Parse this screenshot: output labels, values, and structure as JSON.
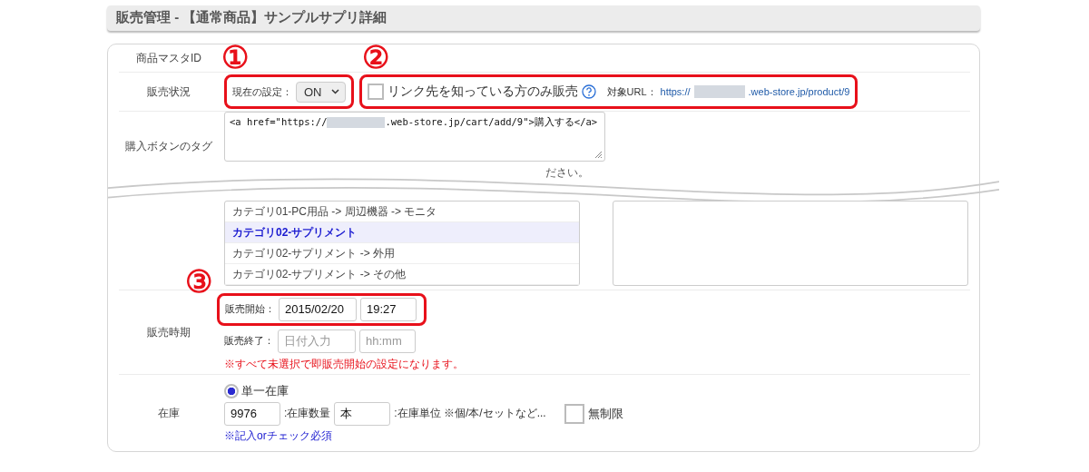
{
  "page_title": "販売管理 - 【通常商品】サンプルサプリ詳細",
  "master_id": {
    "label": "商品マスタID"
  },
  "sales_status": {
    "label": "販売状況",
    "setting_label": "現在の設定：",
    "setting_value": "ON",
    "link_only": {
      "label": "リンク先を知っている方のみ販売",
      "checked": false
    },
    "url_label": "対象URL：",
    "url_prefix": "https://",
    "url_suffix": ".web-store.jp/product/9"
  },
  "buy_tag": {
    "label": "購入ボタンのタグ",
    "code_prefix": "<a href=\"https://",
    "code_suffix": ".web-store.jp/cart/add/9\">購入する</a>",
    "note_fragment": "ださい。"
  },
  "categories": {
    "items": [
      {
        "kind": "item",
        "text": "カテゴリ01-PC用品 -> 周辺機器 -> モニタ"
      },
      {
        "kind": "group",
        "text": "カテゴリ02-サプリメント"
      },
      {
        "kind": "item",
        "text": "カテゴリ02-サプリメント -> 外用"
      },
      {
        "kind": "item",
        "text": "カテゴリ02-サプリメント -> その他"
      }
    ]
  },
  "sales_period": {
    "label": "販売時期",
    "start_label": "販売開始：",
    "start_date": "2015/02/20",
    "start_time": "19:27",
    "end_label": "販売終了：",
    "end_date_placeholder": "日付入力",
    "end_time_placeholder": "hh:mm",
    "note": "※すべて未選択で即販売開始の設定になります。"
  },
  "stock": {
    "label": "在庫",
    "mode": {
      "label": "単一在庫",
      "selected": true
    },
    "quantity": "9976",
    "quantity_label": ":在庫数量",
    "unit": "本",
    "unit_label": ":在庫単位 ※個/本/セットなど...",
    "unlimited": {
      "label": "無制限",
      "checked": false
    },
    "required_note": "※記入orチェック必須"
  },
  "annotations": [
    {
      "number": "①"
    },
    {
      "number": "②"
    },
    {
      "number": "③"
    }
  ]
}
